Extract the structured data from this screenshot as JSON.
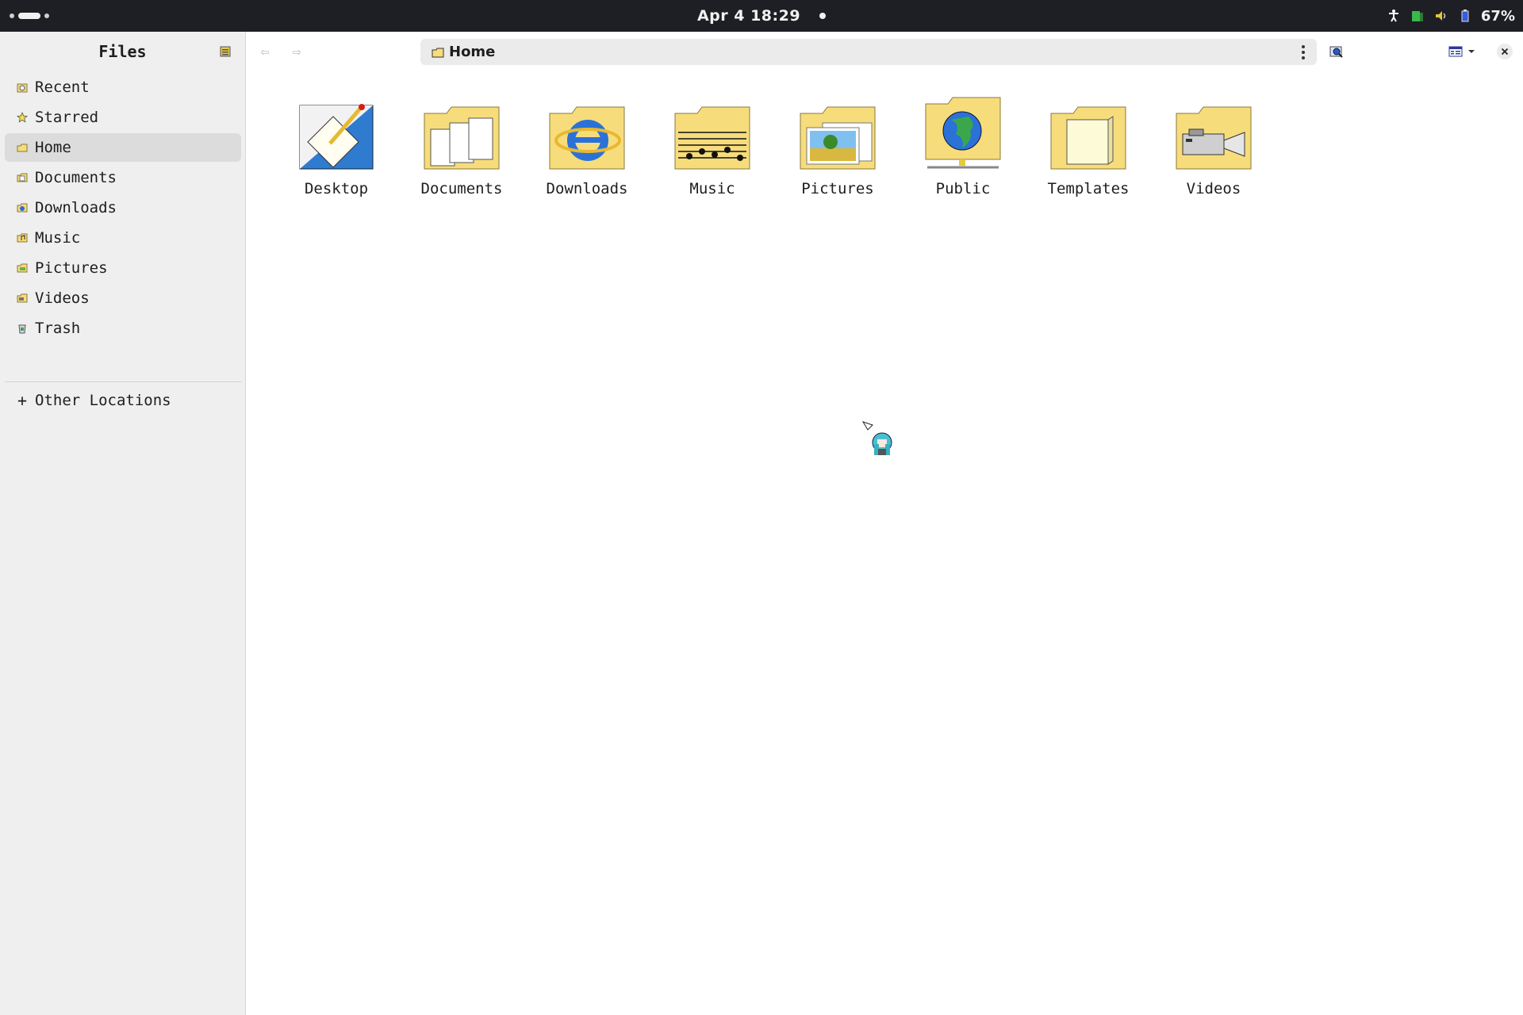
{
  "topbar": {
    "clock": "Apr 4 18:29",
    "battery": "67%",
    "icons": [
      "accessibility-icon",
      "network-icon",
      "volume-icon",
      "battery-icon"
    ]
  },
  "sidebar": {
    "title": "Files",
    "items": [
      {
        "label": "Recent",
        "icon": "recent-icon"
      },
      {
        "label": "Starred",
        "icon": "star-icon"
      },
      {
        "label": "Home",
        "icon": "home-icon",
        "active": true
      },
      {
        "label": "Documents",
        "icon": "documents-icon"
      },
      {
        "label": "Downloads",
        "icon": "downloads-icon"
      },
      {
        "label": "Music",
        "icon": "music-icon"
      },
      {
        "label": "Pictures",
        "icon": "pictures-icon"
      },
      {
        "label": "Videos",
        "icon": "videos-icon"
      },
      {
        "label": "Trash",
        "icon": "trash-icon"
      }
    ],
    "other_locations": "Other Locations"
  },
  "pathbar": {
    "current": "Home"
  },
  "folders": [
    {
      "name": "Desktop",
      "icon": "desktop-folder-icon"
    },
    {
      "name": "Documents",
      "icon": "documents-folder-icon"
    },
    {
      "name": "Downloads",
      "icon": "downloads-folder-icon"
    },
    {
      "name": "Music",
      "icon": "music-folder-icon"
    },
    {
      "name": "Pictures",
      "icon": "pictures-folder-icon"
    },
    {
      "name": "Public",
      "icon": "public-folder-icon"
    },
    {
      "name": "Templates",
      "icon": "templates-folder-icon"
    },
    {
      "name": "Videos",
      "icon": "videos-folder-icon"
    }
  ],
  "colors": {
    "topbar_bg": "#1d1f24",
    "sidebar_bg": "#efefef",
    "active_row": "#dcdcdc",
    "folder_yellow": "#f7dc7c"
  }
}
